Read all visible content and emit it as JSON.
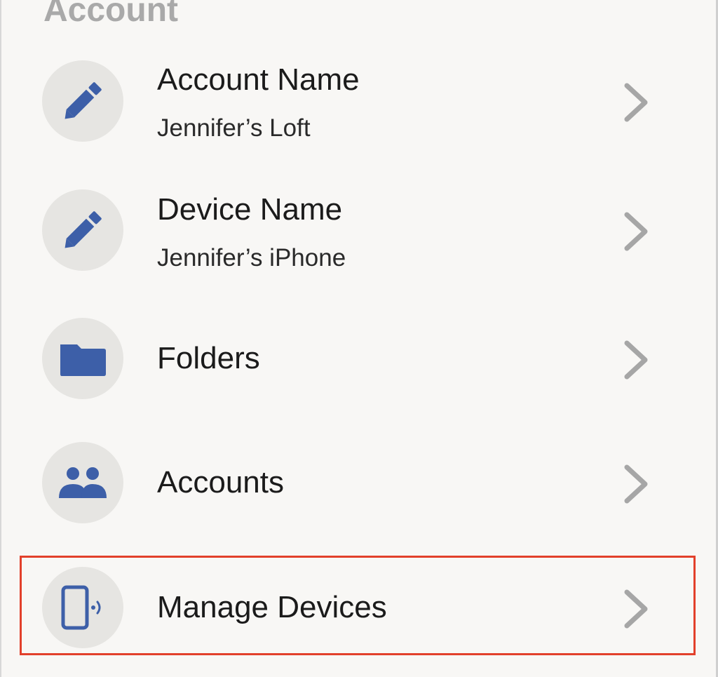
{
  "section": {
    "title": "Account"
  },
  "items": [
    {
      "title": "Account Name",
      "subtitle": "Jennifer’s Loft",
      "icon": "pencil-icon"
    },
    {
      "title": "Device Name",
      "subtitle": "Jennifer’s iPhone",
      "icon": "pencil-icon"
    },
    {
      "title": "Folders",
      "icon": "folder-icon"
    },
    {
      "title": "Accounts",
      "icon": "people-icon"
    },
    {
      "title": "Manage Devices",
      "icon": "phone-signal-icon",
      "highlighted": true
    }
  ],
  "colors": {
    "icon_accent": "#3d5fa8",
    "icon_background": "#e6e5e2",
    "chevron": "#a6a6a6",
    "highlight_border": "#e2402b",
    "section_title": "#a9a9a9",
    "page_background": "#f8f7f5"
  }
}
